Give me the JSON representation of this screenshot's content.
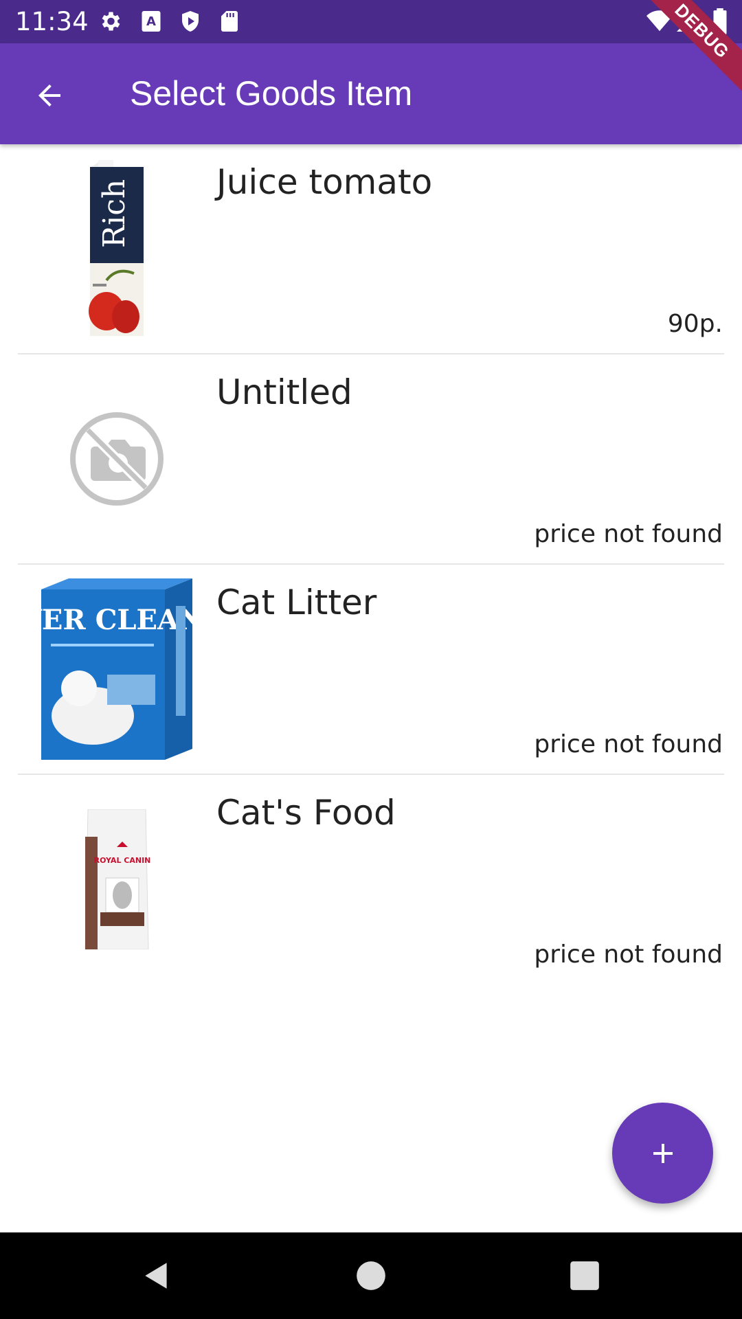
{
  "status_bar": {
    "time": "11:34",
    "icons_left": [
      "settings-icon",
      "a-icon",
      "shield-play-icon",
      "sd-card-icon"
    ],
    "icons_right": [
      "wifi-icon",
      "signal-icon",
      "battery-icon"
    ]
  },
  "debug_banner": "DEBUG",
  "app_bar": {
    "title": "Select Goods Item",
    "back_icon": "arrow-back-icon",
    "color": "#673ab7"
  },
  "items": [
    {
      "name": "Juice tomato",
      "price": "90р.",
      "image": "rich-juice-carton",
      "image_text": "Rich"
    },
    {
      "name": "Untitled",
      "price": "price not found",
      "image": "no-photo-icon"
    },
    {
      "name": "Cat Litter",
      "price": "price not found",
      "image": "ever-clean-box",
      "image_text": "EVER CLEAN"
    },
    {
      "name": "Cat's Food",
      "price": "price not found",
      "image": "royal-canin-bag",
      "image_text": "ROYAL CANIN"
    }
  ],
  "fab": {
    "icon": "plus-icon"
  },
  "nav_bar": {
    "buttons": [
      "back-triangle-icon",
      "home-circle-icon",
      "recents-square-icon"
    ]
  }
}
